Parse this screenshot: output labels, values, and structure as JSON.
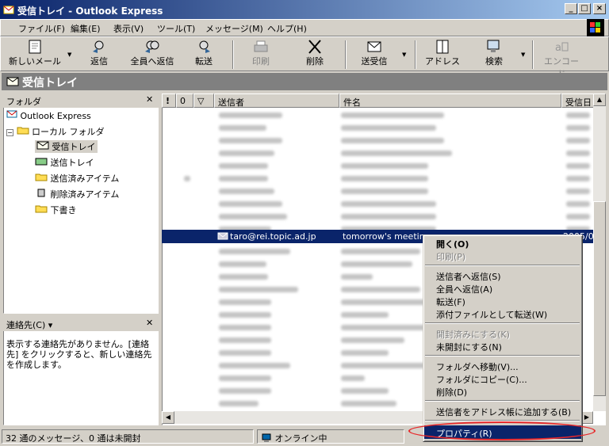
{
  "window": {
    "title": "受信トレイ - Outlook Express"
  },
  "menu": [
    "ファイル(F)",
    "編集(E)",
    "表示(V)",
    "ツール(T)",
    "メッセージ(M)",
    "ヘルプ(H)"
  ],
  "toolbar": {
    "new_mail": "新しいメール",
    "reply": "返信",
    "reply_all": "全員へ返信",
    "forward": "転送",
    "print": "印刷",
    "delete": "削除",
    "send_receive": "送受信",
    "addresses": "アドレス",
    "find": "検索",
    "encode": "エンコード"
  },
  "folder_header": "受信トレイ",
  "folders": {
    "header": "フォルダ",
    "items": [
      "Outlook Express",
      "ローカル フォルダ",
      "受信トレイ",
      "送信トレイ",
      "送信済みアイテム",
      "削除済みアイテム",
      "下書き"
    ]
  },
  "contacts": {
    "header": "連絡先(C) ▾",
    "empty_text": "表示する連絡先がありません。[連絡先] をクリックすると、新しい連絡先を作成します。"
  },
  "columns": {
    "flag": "!",
    "attach": "0",
    "mark": "▽",
    "from": "送信者",
    "subject": "件名",
    "received": "受信日"
  },
  "selected_message": {
    "from": "taro@rei.topic.ad.jp",
    "subject": "tomorrow's meeting",
    "received": "2005/0"
  },
  "context_menu": {
    "items": [
      {
        "label": "開く(O)",
        "bold": true
      },
      {
        "label": "印刷(P)",
        "disabled": true
      },
      {
        "label": "送信者へ返信(S)"
      },
      {
        "label": "全員へ返信(A)"
      },
      {
        "label": "転送(F)"
      },
      {
        "label": "添付ファイルとして転送(W)"
      },
      {
        "label": "開封済みにする(K)",
        "disabled": true
      },
      {
        "label": "未開封にする(N)"
      },
      {
        "label": "フォルダへ移動(V)..."
      },
      {
        "label": "フォルダにコピー(C)..."
      },
      {
        "label": "削除(D)"
      },
      {
        "label": "送信者をアドレス帳に追加する(B)"
      },
      {
        "label": "プロパティ(R)",
        "highlighted": true
      }
    ]
  },
  "status": {
    "count": "32 通のメッセージ、0 通は未開封",
    "online": "オンライン中"
  },
  "colors": {
    "title_start": "#0a246a",
    "title_end": "#a6caf0",
    "selection": "#0a246a",
    "highlight_oval": "#e8282a"
  }
}
